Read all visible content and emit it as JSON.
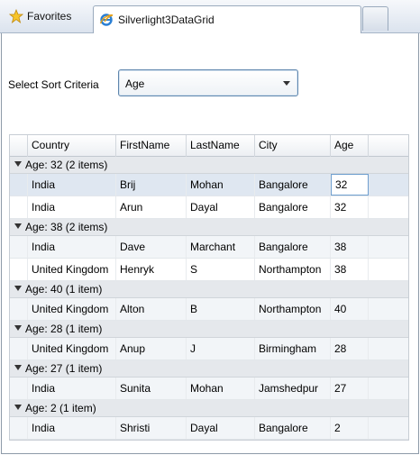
{
  "browser": {
    "favorites_label": "Favorites",
    "tab_title": "Silverlight3DataGrid"
  },
  "sort": {
    "label": "Select Sort Criteria",
    "selected": "Age"
  },
  "grid": {
    "columns": [
      "Country",
      "FirstName",
      "LastName",
      "City",
      "Age"
    ],
    "groups": [
      {
        "header": "Age: 32 (2 items)",
        "rows": [
          [
            "India",
            "Brij",
            "Mohan",
            "Bangalore",
            "32"
          ],
          [
            "India",
            "Arun",
            "Dayal",
            "Bangalore",
            "32"
          ]
        ]
      },
      {
        "header": "Age: 38 (2 items)",
        "rows": [
          [
            "India",
            "Dave",
            "Marchant",
            "Bangalore",
            "38"
          ],
          [
            "United Kingdom",
            "Henryk",
            "S",
            "Northampton",
            "38"
          ]
        ]
      },
      {
        "header": "Age: 40 (1 item)",
        "rows": [
          [
            "United Kingdom",
            "Alton",
            "B",
            "Northampton",
            "40"
          ]
        ]
      },
      {
        "header": "Age: 28 (1 item)",
        "rows": [
          [
            "United Kingdom",
            "Anup",
            "J",
            "Birmingham",
            "28"
          ]
        ]
      },
      {
        "header": "Age: 27 (1 item)",
        "rows": [
          [
            "India",
            "Sunita",
            "Mohan",
            "Jamshedpur",
            "27"
          ]
        ]
      },
      {
        "header": "Age: 2 (1 item)",
        "rows": [
          [
            "India",
            "Shristi",
            "Dayal",
            "Bangalore",
            "2"
          ]
        ]
      }
    ]
  }
}
